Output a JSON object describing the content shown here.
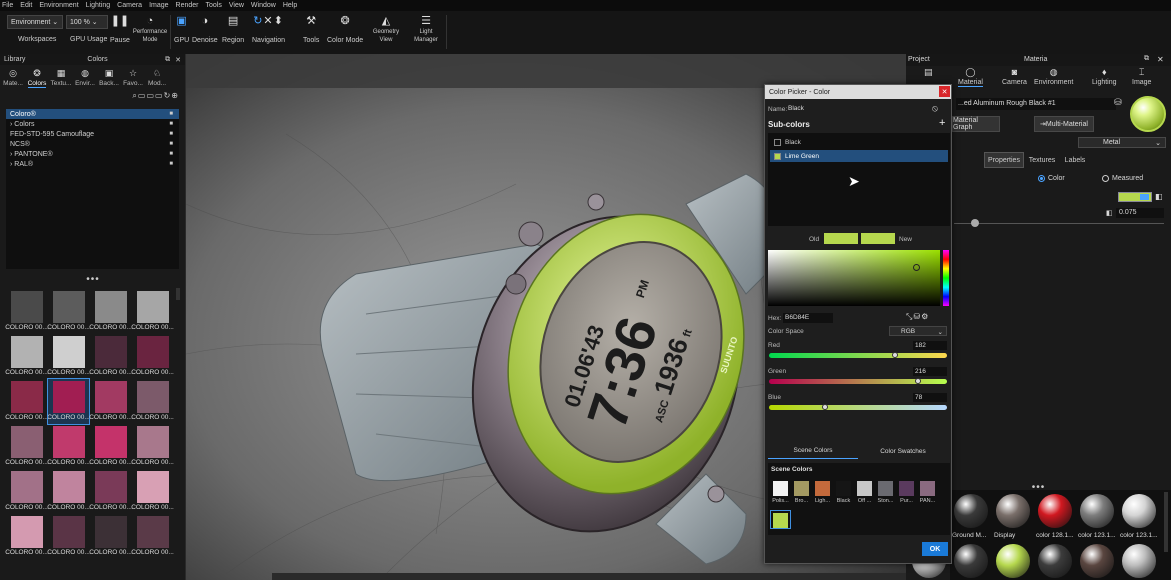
{
  "menu": [
    "File",
    "Edit",
    "Environment",
    "Lighting",
    "Camera",
    "Image",
    "Render",
    "Tools",
    "View",
    "Window",
    "Help"
  ],
  "toolbar": {
    "environment_select": "Environment",
    "zoom_select": "100 %",
    "workspaces": "Workspaces",
    "gpu_usage": "GPU Usage",
    "pause": "Pause",
    "performance_mode": "Performance Mode",
    "gpu": "GPU",
    "denoise": "Denoise",
    "region": "Region",
    "navigation": "Navigation",
    "tools": "Tools",
    "color_mode": "Color Mode",
    "geometry_view": "Geometry View",
    "light_manager": "Light Manager"
  },
  "library": {
    "title": "Library",
    "colors_title": "Colors",
    "tabs": [
      "Mate...",
      "Colors",
      "Textu...",
      "Envir...",
      "Back...",
      "Favo...",
      "Mod..."
    ],
    "list": [
      {
        "label": "Coloro®",
        "selected": true,
        "arrow": ""
      },
      {
        "label": "Colors",
        "selected": false,
        "arrow": "›"
      },
      {
        "label": "FED-STD-595 Camouflage",
        "selected": false,
        "arrow": ""
      },
      {
        "label": "NCS®",
        "selected": false,
        "arrow": ""
      },
      {
        "label": "PANTONE®",
        "selected": false,
        "arrow": "›"
      },
      {
        "label": "RAL®",
        "selected": false,
        "arrow": "›"
      }
    ],
    "swatches": [
      {
        "label": "COLORO 00...",
        "color": "#4a4a4a"
      },
      {
        "label": "COLORO 00...",
        "color": "#5c5c5c"
      },
      {
        "label": "COLORO 00...",
        "color": "#8a8a8a"
      },
      {
        "label": "COLORO 00...",
        "color": "#a6a6a6"
      },
      {
        "label": "COLORO 00...",
        "color": "#b2b2b2"
      },
      {
        "label": "COLORO 00...",
        "color": "#cfcfcf"
      },
      {
        "label": "COLORO 00...",
        "color": "#4b2a3a"
      },
      {
        "label": "COLORO 00...",
        "color": "#6a2440"
      },
      {
        "label": "COLORO 00...",
        "color": "#8a2a48"
      },
      {
        "label": "COLORO 00...",
        "color": "#a11e52"
      },
      {
        "label": "COLORO 00...",
        "color": "#a23a62"
      },
      {
        "label": "COLORO 00...",
        "color": "#7c5a6a"
      },
      {
        "label": "COLORO 00...",
        "color": "#8a5f72"
      },
      {
        "label": "COLORO 00...",
        "color": "#c03a6c"
      },
      {
        "label": "COLORO 00...",
        "color": "#c4336a"
      },
      {
        "label": "COLORO 00...",
        "color": "#a8788c"
      },
      {
        "label": "COLORO 00...",
        "color": "#a27188"
      },
      {
        "label": "COLORO 00...",
        "color": "#c0849e"
      },
      {
        "label": "COLORO 00...",
        "color": "#7a3a58"
      },
      {
        "label": "COLORO 00...",
        "color": "#d8a0b4"
      },
      {
        "label": "COLORO 00...",
        "color": "#d49ab0"
      },
      {
        "label": "COLORO 00...",
        "color": "#5a3446"
      },
      {
        "label": "COLORO 00...",
        "color": "#3c3036"
      },
      {
        "label": "COLORO 00...",
        "color": "#5a3a48"
      }
    ]
  },
  "color_picker": {
    "title": "Color Picker - Color",
    "name_label": "Name:",
    "name_value": "Black",
    "subcolors_title": "Sub-colors",
    "subcolors": [
      {
        "label": "Black",
        "color": "#111111",
        "selected": false
      },
      {
        "label": "Lime Green",
        "color": "#b6d84e",
        "selected": true
      }
    ],
    "old_label": "Old",
    "new_label": "New",
    "old_color": "#b6d84e",
    "new_color": "#b6d84e",
    "hex_label": "Hex:",
    "hex_value": "B6D84E",
    "color_space_label": "Color Space",
    "color_space_value": "RGB",
    "red_label": "Red",
    "red_value": "182",
    "green_label": "Green",
    "green_value": "216",
    "blue_label": "Blue",
    "blue_value": "78",
    "tab_scene": "Scene Colors",
    "tab_swatches": "Color Swatches",
    "scene_header": "Scene Colors",
    "scene_colors": [
      {
        "label": "Polis...",
        "color": "#f2f2f2"
      },
      {
        "label": "Bro...",
        "color": "#a49a62"
      },
      {
        "label": "Ligh...",
        "color": "#c46a3c"
      },
      {
        "label": "Black",
        "color": "#151515"
      },
      {
        "label": "Off ...",
        "color": "#c8c8c8"
      },
      {
        "label": "Ston...",
        "color": "#6a6a70"
      },
      {
        "label": "Pur...",
        "color": "#5a3a5e"
      },
      {
        "label": "PAN...",
        "color": "#8a6a80"
      }
    ],
    "scene_extra": {
      "label": "Lim...",
      "color": "#b6d84e"
    },
    "ok": "OK"
  },
  "material_panel": {
    "project_title": "Project",
    "material_title": "Materia",
    "tabs": [
      "Material",
      "Camera",
      "Environment",
      "Lighting",
      "Image"
    ],
    "material_name": "...ed Aluminum Rough Black #1",
    "material_graph": "Material Graph",
    "multi_material": "Multi-Material",
    "type_select": "Metal",
    "sub_tabs": [
      "Properties",
      "Textures",
      "Labels"
    ],
    "radio_color": "Color",
    "radio_measured": "Measured",
    "roughness_value": "0.075",
    "swatch_color": "#b6d84e",
    "balls": [
      {
        "label": "Ground M...",
        "color": "#3a3a3a"
      },
      {
        "label": "Display",
        "color": "#7a6f6a"
      },
      {
        "label": "color 128.1...",
        "color": "#d11820"
      },
      {
        "label": "color 123.1...",
        "color": "#7d7d7d"
      },
      {
        "label": "color 123.1...",
        "color": "#d4d4d4"
      }
    ],
    "balls_row2": [
      "#cfcfcf",
      "#3a3a3a",
      "#b6d84e",
      "#3c3c3c",
      "#5a4640",
      "#bdbdbd"
    ]
  },
  "watch": {
    "small_top": "01.06'43",
    "time": "7:36",
    "ampm": "PM",
    "bottom_prefix": "ASC",
    "bottom_value": "1936",
    "unit": "ft",
    "brand": "SUUNTO"
  }
}
